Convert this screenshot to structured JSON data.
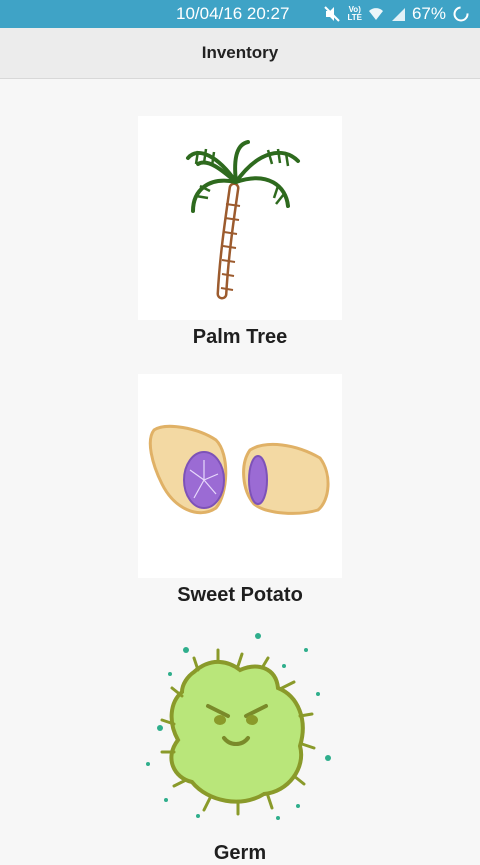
{
  "status_bar": {
    "time": "10/04/16 20:27",
    "network_top": "Vo)",
    "network_bottom": "LTE",
    "battery": "67%"
  },
  "app_bar": {
    "title": "Inventory"
  },
  "items": [
    {
      "label": "Palm Tree",
      "icon": "palm-tree-icon"
    },
    {
      "label": "Sweet Potato",
      "icon": "sweet-potato-icon"
    },
    {
      "label": "Germ",
      "icon": "germ-icon"
    }
  ],
  "colors": {
    "status_bar": "#3fa3c6",
    "app_bar": "#ececec",
    "background": "#f7f7f7"
  }
}
